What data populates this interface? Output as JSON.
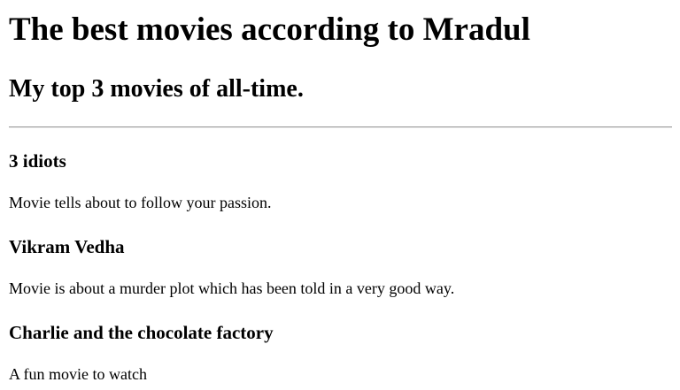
{
  "page": {
    "heading": "The best movies according to Mradul",
    "subheading": "My top 3 movies of all-time."
  },
  "movies": [
    {
      "title": "3 idiots",
      "description": "Movie tells about to follow your passion."
    },
    {
      "title": "Vikram Vedha",
      "description": "Movie is about a murder plot which has been told in a very good way."
    },
    {
      "title": "Charlie and the chocolate factory",
      "description": "A fun movie to watch"
    }
  ]
}
